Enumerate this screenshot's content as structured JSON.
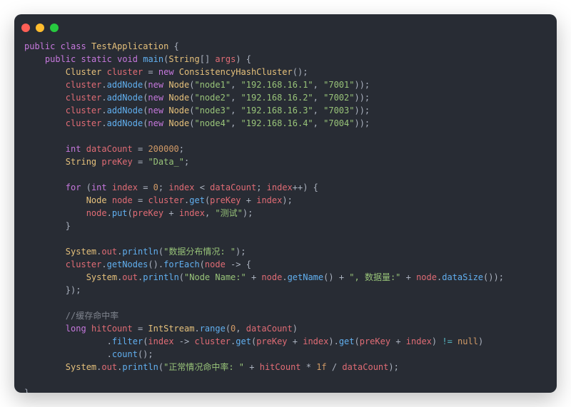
{
  "window": {
    "buttons": [
      "close",
      "minimize",
      "maximize"
    ]
  },
  "tokens": {
    "l1_t1": "public",
    "l1_t2": " ",
    "l1_t3": "class",
    "l1_t4": " ",
    "l1_t5": "TestApplication",
    "l1_t6": " {",
    "l2_t1": "    ",
    "l2_t2": "public",
    "l2_t3": " ",
    "l2_t4": "static",
    "l2_t5": " ",
    "l2_t6": "void",
    "l2_t7": " ",
    "l2_t8": "main",
    "l2_t9": "(",
    "l2_t10": "String",
    "l2_t11": "[] ",
    "l2_t12": "args",
    "l2_t13": ") {",
    "l3_t1": "        ",
    "l3_t2": "Cluster",
    "l3_t3": " ",
    "l3_t4": "cluster",
    "l3_t5": " = ",
    "l3_t6": "new",
    "l3_t7": " ",
    "l3_t8": "ConsistencyHashCluster",
    "l3_t9": "();",
    "l4_t1": "        ",
    "l4_t2": "cluster",
    "l4_t3": ".",
    "l4_t4": "addNode",
    "l4_t5": "(",
    "l4_t6": "new",
    "l4_t7": " ",
    "l4_t8": "Node",
    "l4_t9": "(",
    "l4_t10": "\"node1\"",
    "l4_t11": ", ",
    "l4_t12": "\"192.168.16.1\"",
    "l4_t13": ", ",
    "l4_t14": "\"7001\"",
    "l4_t15": "));",
    "l5_t1": "        ",
    "l5_t2": "cluster",
    "l5_t3": ".",
    "l5_t4": "addNode",
    "l5_t5": "(",
    "l5_t6": "new",
    "l5_t7": " ",
    "l5_t8": "Node",
    "l5_t9": "(",
    "l5_t10": "\"node2\"",
    "l5_t11": ", ",
    "l5_t12": "\"192.168.16.2\"",
    "l5_t13": ", ",
    "l5_t14": "\"7002\"",
    "l5_t15": "));",
    "l6_t1": "        ",
    "l6_t2": "cluster",
    "l6_t3": ".",
    "l6_t4": "addNode",
    "l6_t5": "(",
    "l6_t6": "new",
    "l6_t7": " ",
    "l6_t8": "Node",
    "l6_t9": "(",
    "l6_t10": "\"node3\"",
    "l6_t11": ", ",
    "l6_t12": "\"192.168.16.3\"",
    "l6_t13": ", ",
    "l6_t14": "\"7003\"",
    "l6_t15": "));",
    "l7_t1": "        ",
    "l7_t2": "cluster",
    "l7_t3": ".",
    "l7_t4": "addNode",
    "l7_t5": "(",
    "l7_t6": "new",
    "l7_t7": " ",
    "l7_t8": "Node",
    "l7_t9": "(",
    "l7_t10": "\"node4\"",
    "l7_t11": ", ",
    "l7_t12": "\"192.168.16.4\"",
    "l7_t13": ", ",
    "l7_t14": "\"7004\"",
    "l7_t15": "));",
    "l8_t1": "",
    "l9_t1": "        ",
    "l9_t2": "int",
    "l9_t3": " ",
    "l9_t4": "dataCount",
    "l9_t5": " = ",
    "l9_t6": "200000",
    "l9_t7": ";",
    "l10_t1": "        ",
    "l10_t2": "String",
    "l10_t3": " ",
    "l10_t4": "preKey",
    "l10_t5": " = ",
    "l10_t6": "\"Data_\"",
    "l10_t7": ";",
    "l11_t1": "",
    "l12_t1": "        ",
    "l12_t2": "for",
    "l12_t3": " (",
    "l12_t4": "int",
    "l12_t5": " ",
    "l12_t6": "index",
    "l12_t7": " = ",
    "l12_t8": "0",
    "l12_t9": "; ",
    "l12_t10": "index",
    "l12_t11": " < ",
    "l12_t12": "dataCount",
    "l12_t13": "; ",
    "l12_t14": "index",
    "l12_t15": "++) {",
    "l13_t1": "            ",
    "l13_t2": "Node",
    "l13_t3": " ",
    "l13_t4": "node",
    "l13_t5": " = ",
    "l13_t6": "cluster",
    "l13_t7": ".",
    "l13_t8": "get",
    "l13_t9": "(",
    "l13_t10": "preKey",
    "l13_t11": " + ",
    "l13_t12": "index",
    "l13_t13": ");",
    "l14_t1": "            ",
    "l14_t2": "node",
    "l14_t3": ".",
    "l14_t4": "put",
    "l14_t5": "(",
    "l14_t6": "preKey",
    "l14_t7": " + ",
    "l14_t8": "index",
    "l14_t9": ", ",
    "l14_t10": "\"测试\"",
    "l14_t11": ");",
    "l15_t1": "        }",
    "l16_t1": "",
    "l17_t1": "        ",
    "l17_t2": "System",
    "l17_t3": ".",
    "l17_t4": "out",
    "l17_t5": ".",
    "l17_t6": "println",
    "l17_t7": "(",
    "l17_t8": "\"数据分布情况: \"",
    "l17_t9": ");",
    "l18_t1": "        ",
    "l18_t2": "cluster",
    "l18_t3": ".",
    "l18_t4": "getNodes",
    "l18_t5": "().",
    "l18_t6": "forEach",
    "l18_t7": "(",
    "l18_t8": "node",
    "l18_t9": " -> {",
    "l19_t1": "            ",
    "l19_t2": "System",
    "l19_t3": ".",
    "l19_t4": "out",
    "l19_t5": ".",
    "l19_t6": "println",
    "l19_t7": "(",
    "l19_t8": "\"Node Name:\"",
    "l19_t9": " + ",
    "l19_t10": "node",
    "l19_t11": ".",
    "l19_t12": "getName",
    "l19_t13": "() + ",
    "l19_t14": "\", 数据量:\"",
    "l19_t15": " + ",
    "l19_t16": "node",
    "l19_t17": ".",
    "l19_t18": "dataSize",
    "l19_t19": "());",
    "l20_t1": "        });",
    "l21_t1": "",
    "l22_t1": "        ",
    "l22_t2": "//缓存命中率",
    "l23_t1": "        ",
    "l23_t2": "long",
    "l23_t3": " ",
    "l23_t4": "hitCount",
    "l23_t5": " = ",
    "l23_t6": "IntStream",
    "l23_t7": ".",
    "l23_t8": "range",
    "l23_t9": "(",
    "l23_t10": "0",
    "l23_t11": ", ",
    "l23_t12": "dataCount",
    "l23_t13": ")",
    "l24_t1": "                .",
    "l24_t2": "filter",
    "l24_t3": "(",
    "l24_t4": "index",
    "l24_t5": " -> ",
    "l24_t6": "cluster",
    "l24_t7": ".",
    "l24_t8": "get",
    "l24_t9": "(",
    "l24_t10": "preKey",
    "l24_t11": " + ",
    "l24_t12": "index",
    "l24_t13": ").",
    "l24_t14": "get",
    "l24_t15": "(",
    "l24_t16": "preKey",
    "l24_t17": " + ",
    "l24_t18": "index",
    "l24_t19": ") ",
    "l24_t20": "!=",
    "l24_t21": " ",
    "l24_t22": "null",
    "l24_t23": ")",
    "l25_t1": "                .",
    "l25_t2": "count",
    "l25_t3": "();",
    "l26_t1": "        ",
    "l26_t2": "System",
    "l26_t3": ".",
    "l26_t4": "out",
    "l26_t5": ".",
    "l26_t6": "println",
    "l26_t7": "(",
    "l26_t8": "\"正常情况命中率: \"",
    "l26_t9": " + ",
    "l26_t10": "hitCount",
    "l26_t11": " * ",
    "l26_t12": "1f",
    "l26_t13": " / ",
    "l26_t14": "dataCount",
    "l26_t15": ");",
    "l27_t1": "",
    "l28_t1": "}"
  }
}
